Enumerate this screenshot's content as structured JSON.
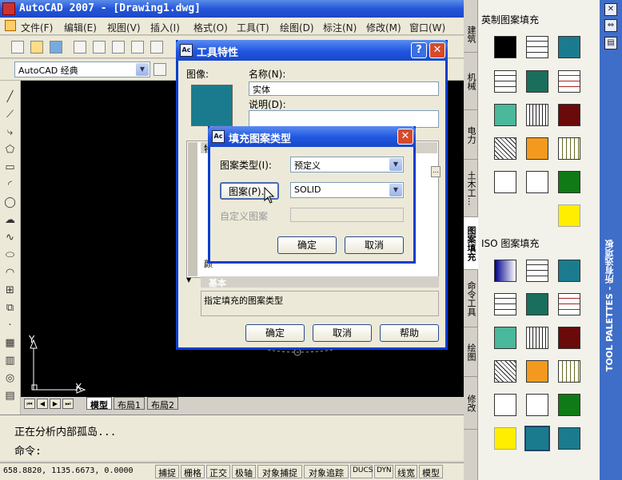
{
  "app": {
    "title": "AutoCAD 2007 - [Drawing1.dwg]"
  },
  "menu": [
    "文件(F)",
    "编辑(E)",
    "视图(V)",
    "插入(I)",
    "格式(O)",
    "工具(T)",
    "绘图(D)",
    "标注(N)",
    "修改(M)",
    "窗口(W)"
  ],
  "workspace": {
    "value": "AutoCAD 经典"
  },
  "layout_tabs": [
    "模型",
    "布局1",
    "布局2"
  ],
  "command": {
    "line1": "正在分析内部孤岛...",
    "line2": "命令:"
  },
  "status": {
    "coords": "658.8820, 1135.6673, 0.0000",
    "buttons": [
      "捕捉",
      "栅格",
      "正交",
      "极轴",
      "对象捕捉",
      "对象追踪",
      "DUCS",
      "DYN",
      "线宽",
      "模型"
    ]
  },
  "ucs": {
    "x": "X",
    "y": "Y"
  },
  "tool_properties": {
    "title": "工具特性",
    "image_label": "图像:",
    "name_label": "名称(N):",
    "name_value": "实体",
    "desc_label": "说明(D):",
    "desc_value": "",
    "section_basic": "基本",
    "partial_row": "特",
    "partial_row2": "颜",
    "help_text": "指定填充的图案类型",
    "ok": "确定",
    "cancel": "取消",
    "help": "帮助",
    "swatch_color": "#1b7b8e"
  },
  "hatch_type": {
    "title": "填充图案类型",
    "type_label": "图案类型(I):",
    "type_value": "预定义",
    "pattern_button": "图案(P)...",
    "pattern_value": "SOLID",
    "custom_label": "自定义图案",
    "ok": "确定",
    "cancel": "取消"
  },
  "palette": {
    "tabs": [
      "建筑",
      "机械",
      "电力",
      "土木工...",
      "图案填充",
      "命令工具",
      "绘图",
      "修改"
    ],
    "active_tab": "图案填充",
    "side_title": "TOOL PALETTES - 所有选项板",
    "section1": "英制图案填充",
    "section2": "ISO 图案填充",
    "colors": {
      "teal": "#1b7b8e",
      "green": "#1a6e5c",
      "lightgreen": "#4ab89a",
      "maroon": "#6b0a0a",
      "orange": "#f39a1e",
      "black": "#000000",
      "brightgreen": "#0f7a16",
      "yellow": "#ffee00"
    }
  }
}
